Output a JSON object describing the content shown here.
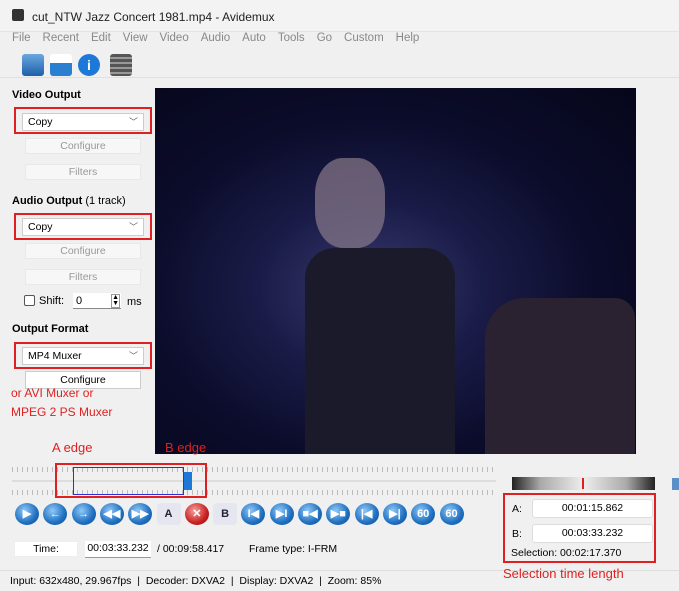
{
  "window": {
    "title": "cut_NTW Jazz Concert 1981.mp4 - Avidemux",
    "icon": "clapperboard-icon"
  },
  "menu": [
    "File",
    "Recent",
    "Edit",
    "View",
    "Video",
    "Audio",
    "Auto",
    "Tools",
    "Go",
    "Custom",
    "Help"
  ],
  "toolbar": [
    {
      "icon": "open-folder-icon"
    },
    {
      "icon": "save-download-icon"
    },
    {
      "icon": "info-icon"
    },
    {
      "icon": "film-filter-icon"
    }
  ],
  "left": {
    "video_output": {
      "label": "Video Output",
      "value": "Copy",
      "configure": "Configure",
      "filters": "Filters"
    },
    "audio_output": {
      "label": "Audio Output",
      "sub": "(1 track)",
      "value": "Copy",
      "configure": "Configure",
      "filters": "Filters",
      "shift_label": "Shift:",
      "shift_value": "0",
      "shift_unit": "ms",
      "shift_checked": false
    },
    "output_format": {
      "label": "Output Format",
      "value": "MP4 Muxer",
      "configure": "Configure"
    },
    "note_line1": "or AVI Muxer or",
    "note_line2": "MPEG 2 PS Muxer"
  },
  "annotations": {
    "a_edge": "A edge",
    "b_edge": "B edge",
    "selection_length": "Selection time length"
  },
  "controls": [
    {
      "icon": "play-icon",
      "glyph": "▶"
    },
    {
      "icon": "previous-frame-icon",
      "glyph": "←"
    },
    {
      "icon": "next-frame-icon",
      "glyph": "→"
    },
    {
      "icon": "rewind-icon",
      "glyph": "◀◀"
    },
    {
      "icon": "fast-forward-icon",
      "glyph": "▶▶"
    },
    {
      "icon": "set-marker-a-icon",
      "glyph": "A"
    },
    {
      "icon": "clear-markers-icon",
      "glyph": "✕"
    },
    {
      "icon": "set-marker-b-icon",
      "glyph": "B"
    },
    {
      "icon": "goto-marker-a-icon",
      "glyph": "I◀"
    },
    {
      "icon": "goto-marker-b-icon",
      "glyph": "▶I"
    },
    {
      "icon": "previous-black-frame-icon",
      "glyph": "■◀"
    },
    {
      "icon": "next-black-frame-icon",
      "glyph": "▶■"
    },
    {
      "icon": "first-frame-icon",
      "glyph": "|◀"
    },
    {
      "icon": "last-frame-icon",
      "glyph": "▶|"
    },
    {
      "icon": "back-60s-icon",
      "glyph": "60"
    },
    {
      "icon": "forward-60s-icon",
      "glyph": "60"
    }
  ],
  "time": {
    "button": "Time:",
    "current": "00:03:33.232",
    "total": "/ 00:09:58.417",
    "frame_type": "Frame type:  I-FRM"
  },
  "selection": {
    "a_label": "A:",
    "a_value": "00:01:15.862",
    "b_label": "B:",
    "b_value": "00:03:33.232",
    "selection": "Selection: 00:02:17.370"
  },
  "timeline": {
    "marker_a_percent": 12.7,
    "marker_b_percent": 35.6,
    "position_percent": 35.6
  },
  "status": "Input: 632x480, 29.967fps  |  Decoder: DXVA2  |  Display: DXVA2  |  Zoom: 85%",
  "colors": {
    "annotation": "#e02020",
    "accent": "#1e78d7"
  }
}
